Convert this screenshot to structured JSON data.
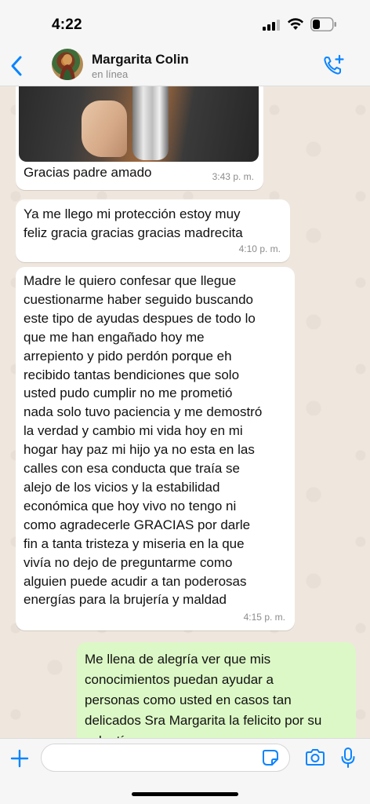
{
  "status_bar": {
    "time": "4:22"
  },
  "header": {
    "contact_name": "Margarita Colin",
    "contact_status": "en línea"
  },
  "messages": [
    {
      "direction": "incoming",
      "type": "image",
      "caption": "Gracias padre amado",
      "time": "3:43 p. m."
    },
    {
      "direction": "incoming",
      "type": "text",
      "text": "Ya me llego mi protección estoy muy\nfeliz gracia gracias gracias madrecita",
      "time": "4:10 p. m."
    },
    {
      "direction": "incoming",
      "type": "text",
      "text": "Madre le quiero confesar que llegue\ncuestionarme  haber seguido  buscando\neste tipo de ayudas despues de todo lo\nque me han engañado hoy me\narrepiento y pido perdón porque eh\nrecibido tantas bendiciones que solo\nusted pudo cumplir  no me prometió\nnada solo tuvo paciencia y me demostró\nla verdad y cambio mi vida hoy en mi\nhogar hay paz mi hijo ya no esta en las\ncalles con esa conducta que traía se\nalejo de los vicios y la estabilidad\neconómica que hoy vivo no tengo ni\ncomo agradecerle  GRACIAS por darle\nfin a tanta tristeza y miseria en la que\nvivía no dejo de preguntarme como\nalguien puede acudir a tan poderosas\nenergías para la brujería y maldad",
      "time": "4:15 p. m."
    },
    {
      "direction": "outgoing",
      "type": "text",
      "text": "Me llena de alegría ver que mis\nconocimientos puedan  ayudar a\npersonas como usted en casos tan\ndelicados Sra Margarita la felicito por su\nvalentía"
    }
  ],
  "input": {
    "value": "",
    "placeholder": ""
  },
  "colors": {
    "accent": "#0a84ff",
    "chat_background": "#efe7de",
    "incoming_bubble": "#ffffff",
    "outgoing_bubble": "#dcf8c6"
  },
  "icons": [
    "back-chevron-icon",
    "add-call-icon",
    "plus-icon",
    "sticker-icon",
    "camera-icon",
    "microphone-icon",
    "signal-icon",
    "wifi-icon",
    "battery-icon"
  ]
}
